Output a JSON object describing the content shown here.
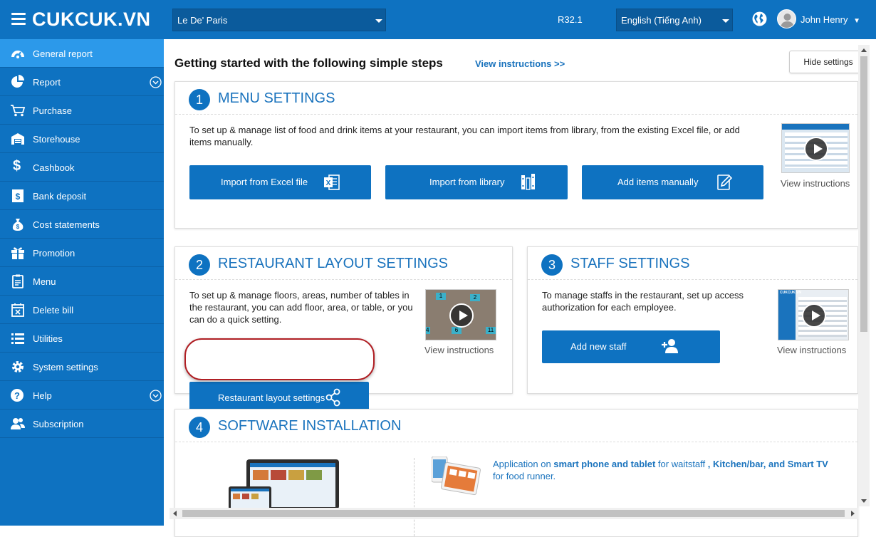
{
  "header": {
    "logo": "CUKCUK.VN",
    "restaurant": "Le De' Paris",
    "version": "R32.1",
    "language": "English (Tiếng Anh)",
    "user": "John Henry"
  },
  "sidebar": {
    "items": [
      {
        "label": "General report",
        "icon": "dashboard-icon"
      },
      {
        "label": "Report",
        "icon": "pie-chart-icon"
      },
      {
        "label": "Purchase",
        "icon": "cart-icon"
      },
      {
        "label": "Storehouse",
        "icon": "warehouse-icon"
      },
      {
        "label": "Cashbook",
        "icon": "dollar-icon"
      },
      {
        "label": "Bank deposit",
        "icon": "bank-icon"
      },
      {
        "label": "Cost statements",
        "icon": "money-bag-icon"
      },
      {
        "label": "Promotion",
        "icon": "gift-icon"
      },
      {
        "label": "Menu",
        "icon": "clipboard-icon"
      },
      {
        "label": "Delete bill",
        "icon": "calendar-x-icon"
      },
      {
        "label": "Utilities",
        "icon": "list-icon"
      },
      {
        "label": "System settings",
        "icon": "gear-icon"
      },
      {
        "label": "Help",
        "icon": "question-icon"
      },
      {
        "label": "Subscription",
        "icon": "users-icon"
      }
    ]
  },
  "main": {
    "heading": "Getting started with the following simple steps",
    "view_instructions_link": "View instructions >>",
    "hide_settings": "Hide settings",
    "step1": {
      "num": "1",
      "title": "MENU SETTINGS",
      "desc": "To set up & manage list of food and drink items at your restaurant, you can import items from library, from the existing Excel file, or add items manually.",
      "btn_excel": "Import from Excel file",
      "btn_library": "Import from library",
      "btn_manual": "Add items manually",
      "view": "View instructions"
    },
    "step2": {
      "num": "2",
      "title": "RESTAURANT LAYOUT SETTINGS",
      "desc": "To set up & manage floors, areas, number of tables in the restaurant, you can add floor, area, or table, or you can do a quick setting.",
      "btn": "Restaurant layout settings",
      "view": "View instructions",
      "thumb_numbers": [
        "1",
        "2",
        "6",
        "11",
        "4"
      ]
    },
    "step3": {
      "num": "3",
      "title": "STAFF SETTINGS",
      "desc": "To manage staffs in the restaurant, set up access authorization for each employee.",
      "btn": "Add new staff",
      "view": "View instructions",
      "thumb_logo": "CUKCUK.VN"
    },
    "step4": {
      "num": "4",
      "title": "SOFTWARE INSTALLATION",
      "app_text_1": "Application on ",
      "app_bold_1": "smart phone and tablet",
      "app_text_2": " for waitstaff ",
      "app_bold_2": ", Kitchen/bar, and Smart TV",
      "app_text_3": " for food runner."
    }
  },
  "colors": {
    "primary": "#0e72c1",
    "active": "#2c99ea",
    "link": "#1a73bd",
    "highlight": "#b01f24"
  }
}
